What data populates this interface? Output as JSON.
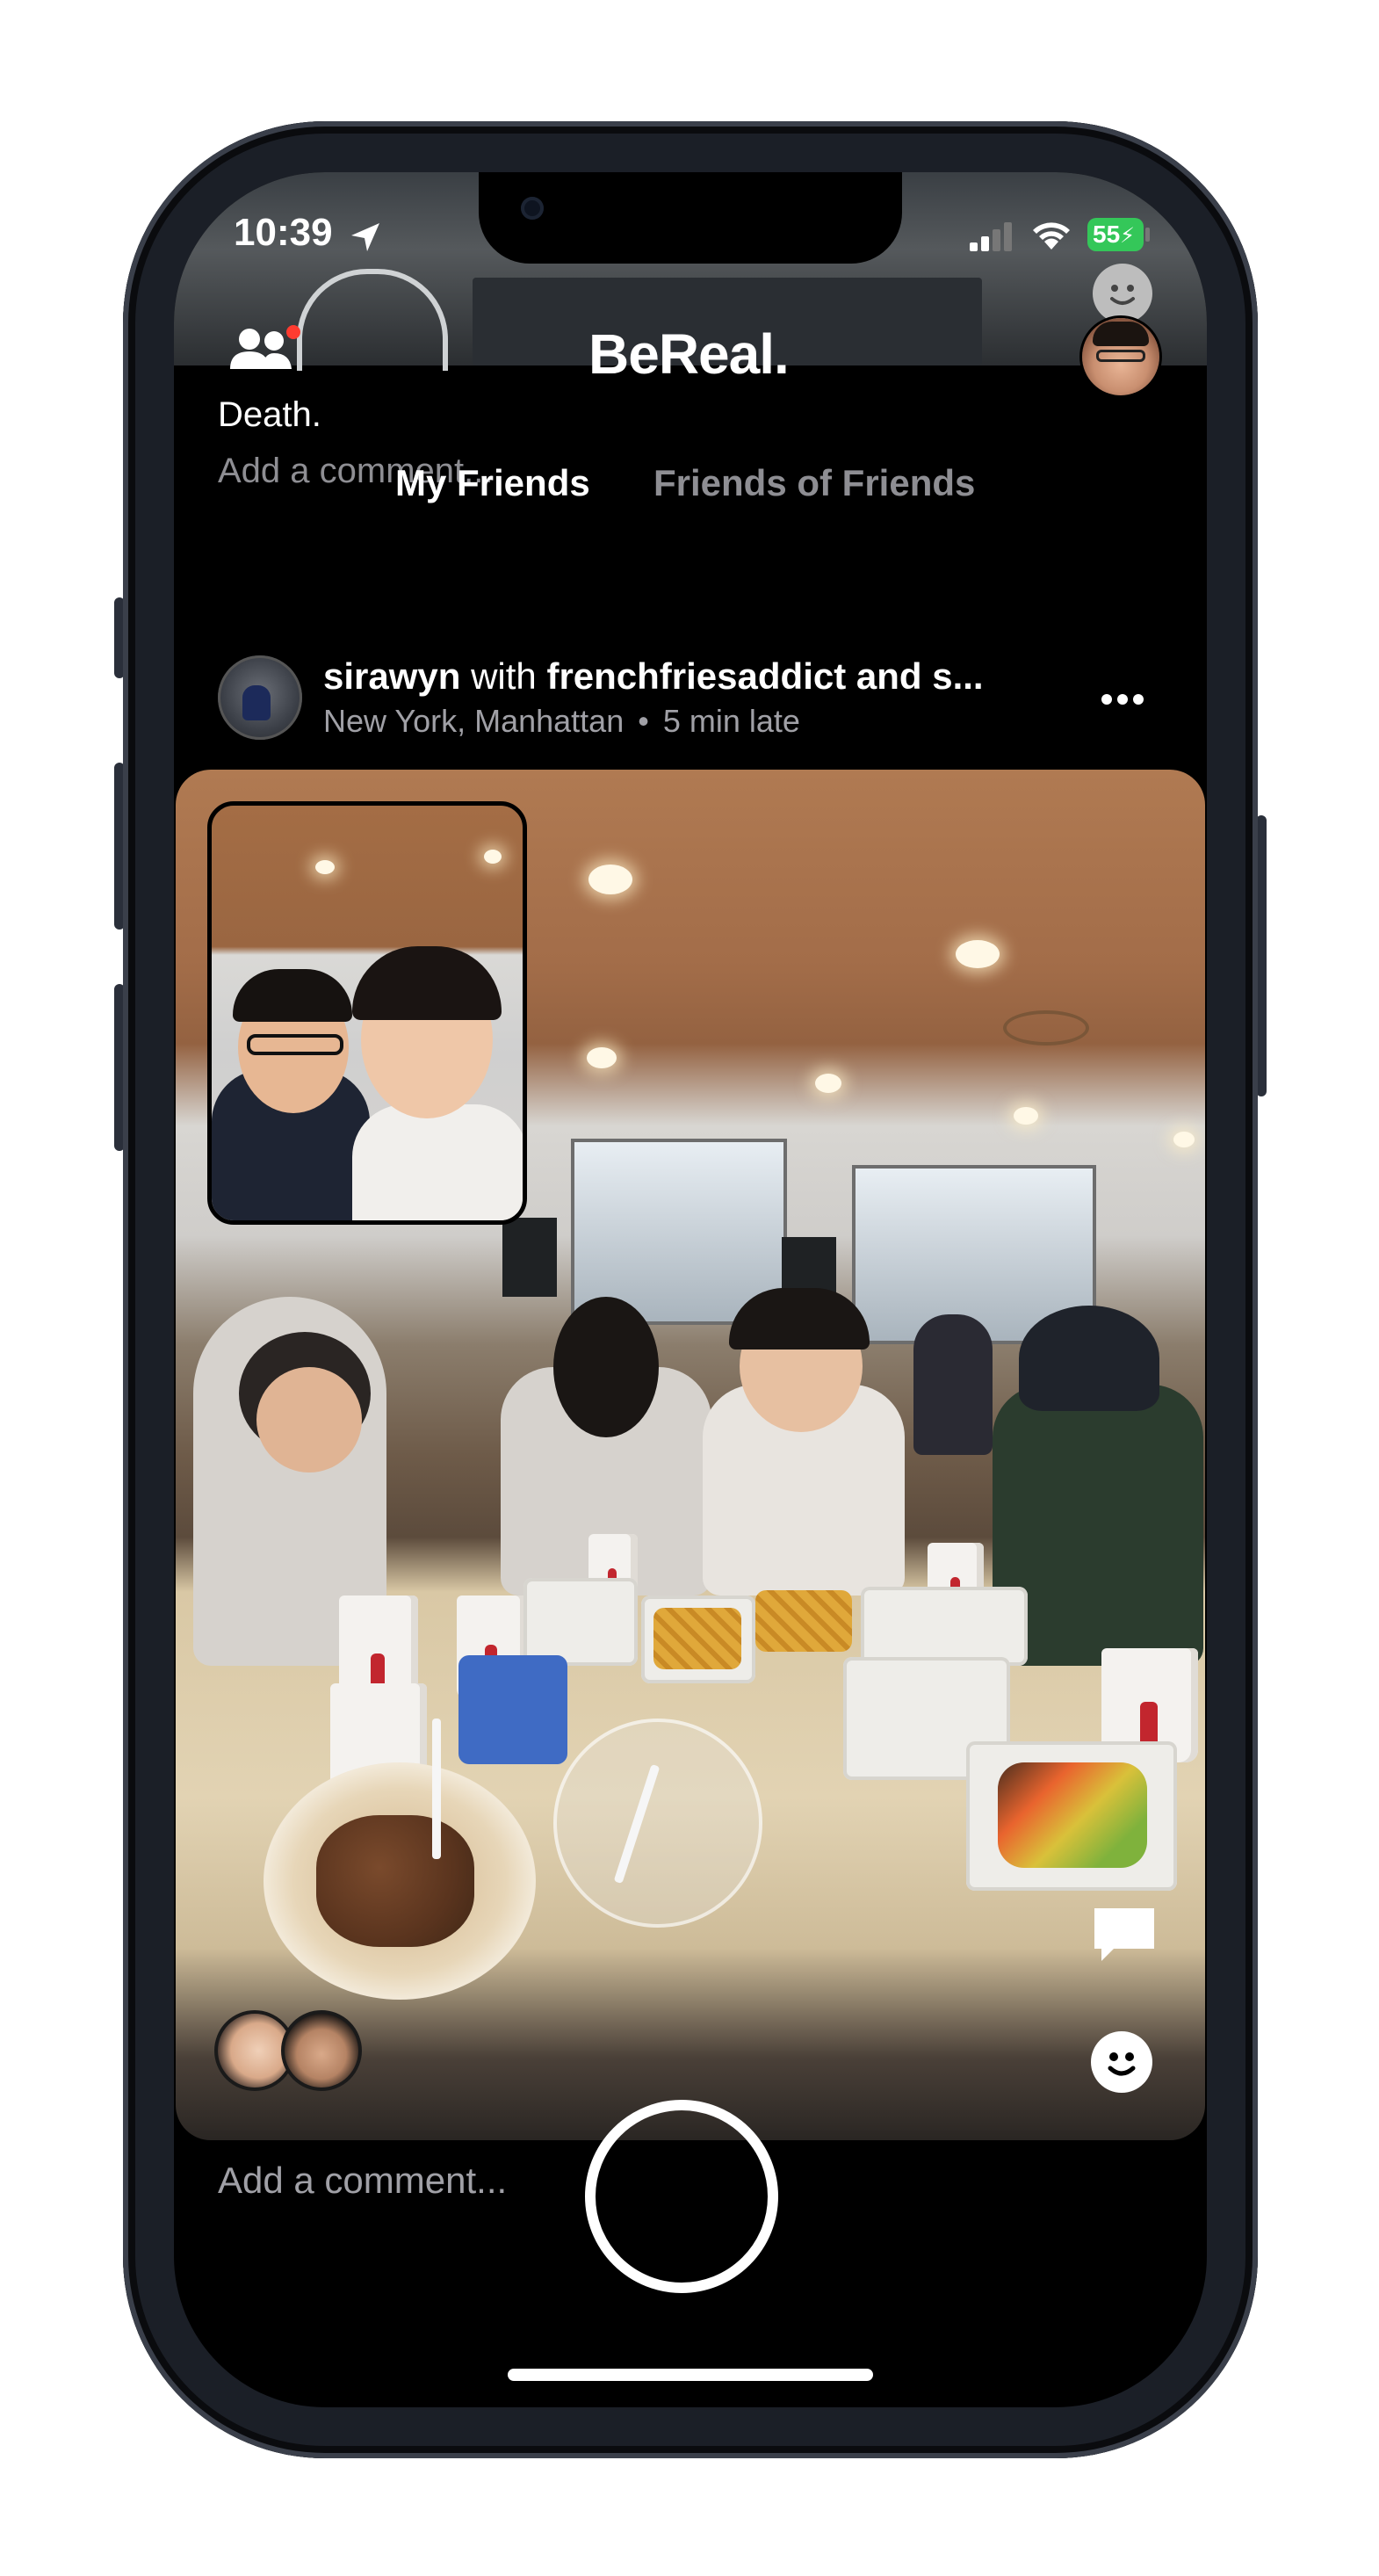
{
  "status_bar": {
    "time": "10:39",
    "battery": "55",
    "icons": [
      "location-arrow-icon",
      "cellular-signal-icon",
      "wifi-icon",
      "battery-charging-icon"
    ]
  },
  "header": {
    "logo": "BeReal.",
    "friends_icon": "friends-icon",
    "friends_notification": true,
    "profile_icon": "profile-avatar",
    "smiley_icon": "smiley-icon"
  },
  "own_post": {
    "caption": "Death.",
    "comment_placeholder": "Add a comment..."
  },
  "tabs": [
    {
      "label": "My Friends",
      "active": true
    },
    {
      "label": "Friends of Friends",
      "active": false
    }
  ],
  "post": {
    "username": "sirawyn",
    "with_text": " with ",
    "tagged_user": "frenchfriesaddict",
    "and_text": " and s...",
    "location": "New York, Manhattan",
    "separator": "•",
    "lateness": "5 min late",
    "more_icon": "more-dots-icon",
    "comment_placeholder": "Add a comment...",
    "overlay_icons": [
      "comment-bubble-icon",
      "react-smiley-icon"
    ]
  },
  "colors": {
    "background": "#000000",
    "text_primary": "#ffffff",
    "text_secondary": "#8e8e93",
    "notification_dot": "#ff3b30",
    "battery_green": "#34c759"
  }
}
